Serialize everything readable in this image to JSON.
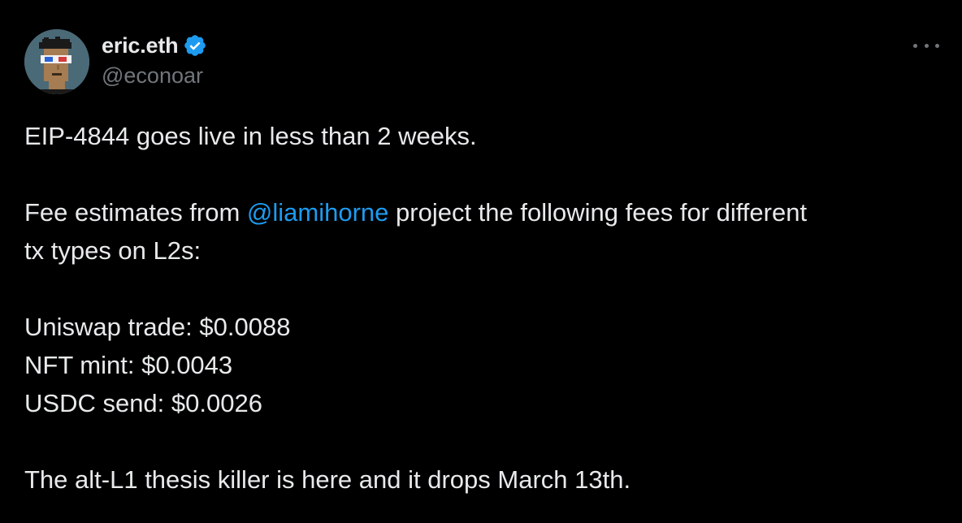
{
  "author": {
    "display_name": "eric.eth",
    "handle": "@econoar",
    "verified": true
  },
  "colors": {
    "background": "#000000",
    "text": "#e7e9ea",
    "secondary_text": "#71767b",
    "link": "#1d9bf0",
    "verified_badge": "#1d9bf0"
  },
  "icons": {
    "verified": "verified-badge-icon",
    "more": "more-options-icon"
  },
  "tweet": {
    "line1": "EIP-4844 goes live in less than 2 weeks.",
    "line2_pre": "Fee estimates from ",
    "mention": "@liamihorne",
    "line2_post": " project the following fees for different",
    "line3": "tx types on L2s:",
    "fee1": "Uniswap trade: $0.0088",
    "fee2": "NFT mint: $0.0043",
    "fee3": "USDC send: $0.0026",
    "closing": "The alt-L1 thesis killer is here and it drops March 13th."
  }
}
